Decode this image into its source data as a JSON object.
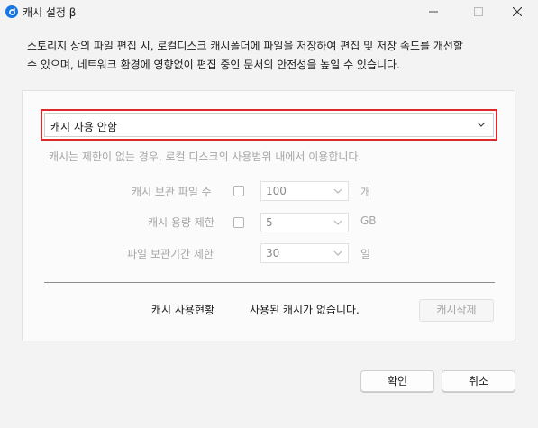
{
  "window": {
    "title": "캐시 설정 β",
    "minimize_icon": "minimize-icon",
    "maximize_icon": "maximize-icon",
    "close_icon": "close-icon"
  },
  "description_line1": "스토리지 상의 파일 편집 시, 로컬디스크 캐시폴더에 파일을 저장하여 편집 및 저장 속도를 개선할",
  "description_line2": "수 있으며, 네트워크 환경에 영향없이 편집 중인 문서의 안전성을 높일 수 있습니다.",
  "cache_mode": {
    "selected": "캐시 사용 안함",
    "highlight_color": "#e0282b"
  },
  "note": "캐시는 제한이 없는 경우, 로컬 디스크의 사용범위 내에서 이용합니다.",
  "settings": {
    "file_count": {
      "label": "캐시 보관 파일 수",
      "value": "100",
      "unit": "개",
      "checked": false
    },
    "capacity": {
      "label": "캐시 용량 제한",
      "value": "5",
      "unit": "GB",
      "checked": false
    },
    "retention": {
      "label": "파일 보관기간 제한",
      "value": "30",
      "unit": "일"
    }
  },
  "usage": {
    "label": "캐시 사용현황",
    "value": "사용된 캐시가 없습니다.",
    "clear_button": "캐시삭제"
  },
  "buttons": {
    "ok": "확인",
    "cancel": "취소"
  }
}
